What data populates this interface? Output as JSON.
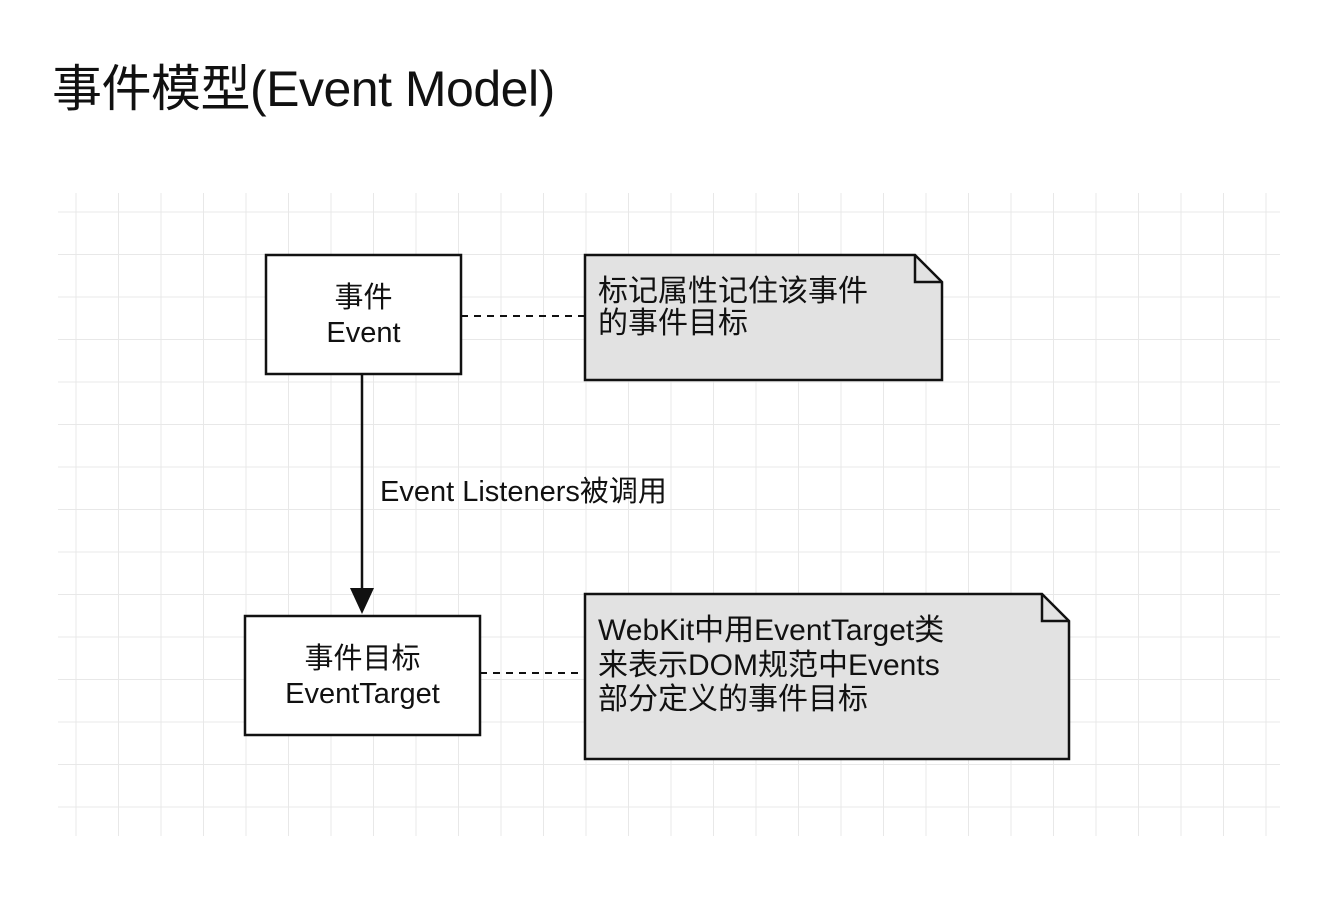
{
  "page": {
    "title": "事件模型(Event Model)"
  },
  "diagram": {
    "nodes": [
      {
        "id": "event",
        "lines": [
          "事件",
          "Event"
        ]
      },
      {
        "id": "event_target",
        "lines": [
          "事件目标",
          "EventTarget"
        ]
      }
    ],
    "notes": [
      {
        "id": "note_event",
        "lines": [
          "标记属性记住该事件",
          "的事件目标"
        ]
      },
      {
        "id": "note_event_target",
        "lines": [
          "WebKit中用EventTarget类",
          "来表示DOM规范中Events",
          "部分定义的事件目标"
        ]
      }
    ],
    "edges": [
      {
        "from": "event",
        "to": "event_target",
        "label": "Event Listeners被调用",
        "style": "solid-arrow"
      },
      {
        "from": "event",
        "to": "note_event",
        "style": "dashed"
      },
      {
        "from": "event_target",
        "to": "note_event_target",
        "style": "dashed"
      }
    ],
    "colors": {
      "grid": "#e8e8e8",
      "node_fill": "#ffffff",
      "note_fill": "#e2e2e2",
      "stroke": "#111111"
    }
  }
}
